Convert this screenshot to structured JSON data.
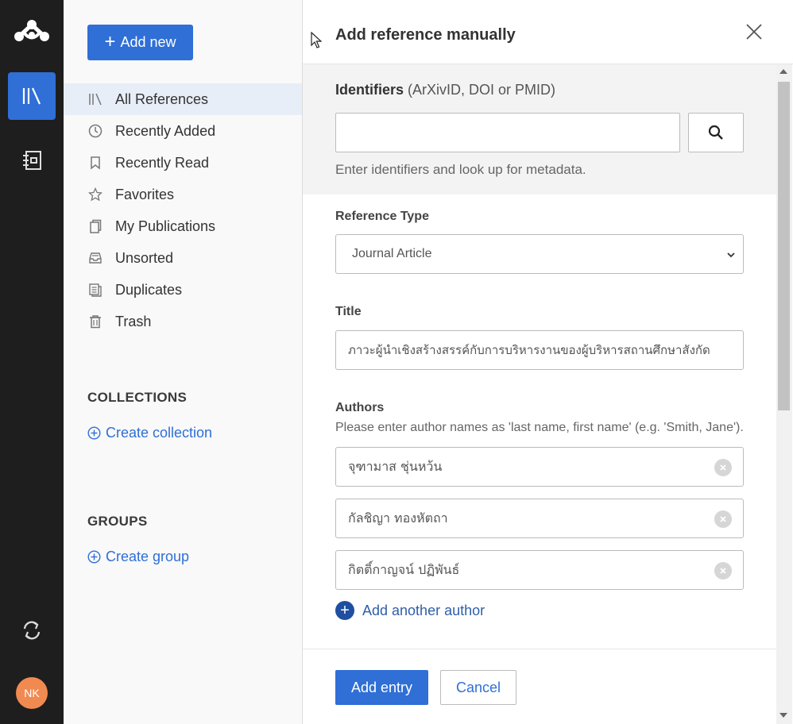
{
  "sidebar": {
    "add_new_label": "Add new",
    "items": [
      {
        "label": "All References",
        "icon": "library-icon",
        "active": true
      },
      {
        "label": "Recently Added",
        "icon": "clock-icon"
      },
      {
        "label": "Recently Read",
        "icon": "bookmark-icon"
      },
      {
        "label": "Favorites",
        "icon": "star-icon"
      },
      {
        "label": "My Publications",
        "icon": "publications-icon"
      },
      {
        "label": "Unsorted",
        "icon": "inbox-icon"
      },
      {
        "label": "Duplicates",
        "icon": "duplicates-icon"
      },
      {
        "label": "Trash",
        "icon": "trash-icon"
      }
    ],
    "collections_heading": "COLLECTIONS",
    "create_collection": "Create collection",
    "groups_heading": "GROUPS",
    "create_group": "Create group"
  },
  "rail": {
    "avatar_initials": "NK"
  },
  "dialog": {
    "title": "Add reference manually",
    "identifiers_label": "Identifiers",
    "identifiers_hint": "(ArXivID, DOI or PMID)",
    "identifiers_value": "",
    "identifiers_help": "Enter identifiers and look up for metadata.",
    "reference_type_label": "Reference Type",
    "reference_type_value": "Journal Article",
    "title_label": "Title",
    "title_value": "ภาวะผู้นำเชิงสร้างสรรค์กับการบริหารงานของผู้บริหารสถานศึกษาสังกัด",
    "authors_label": "Authors",
    "authors_help": "Please enter author names as 'last name, first name' (e.g. 'Smith, Jane').",
    "authors": [
      "จุฑามาส ชุ่นหว้น",
      "กัลชิญา ทองหัตถา",
      "กิตติ์กาญจน์ ปฏิพันธ์"
    ],
    "add_author_label": "Add another author",
    "add_entry_label": "Add entry",
    "cancel_label": "Cancel"
  },
  "colors": {
    "accent": "#2f6fd6",
    "rail": "#1e1e1e",
    "avatar": "#f08a51"
  }
}
